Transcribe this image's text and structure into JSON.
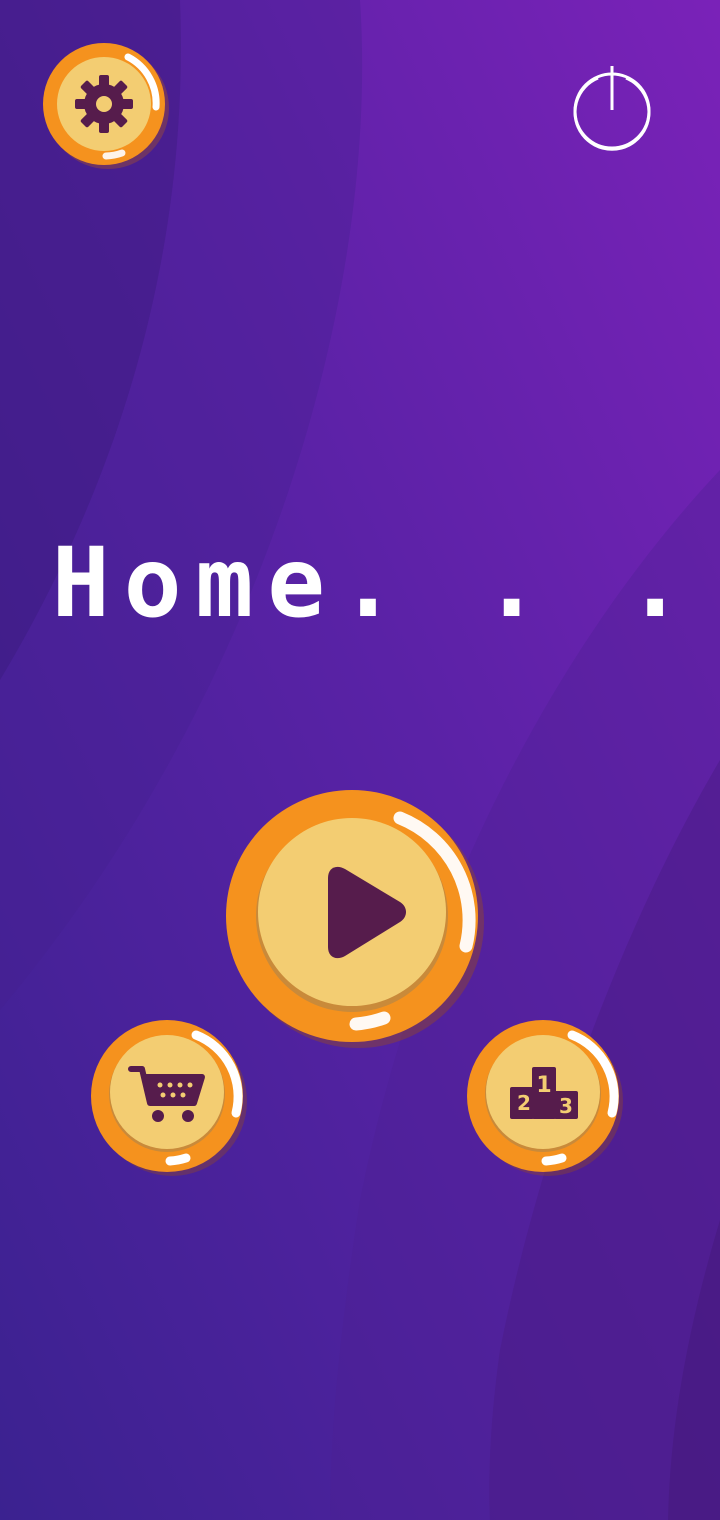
{
  "screen": {
    "title": "Home. . ."
  },
  "buttons": {
    "settings": {
      "icon": "gear-icon"
    },
    "power": {
      "icon": "power-icon"
    },
    "play": {
      "icon": "play-icon"
    },
    "shop": {
      "icon": "shopping-cart-icon"
    },
    "leaderboard": {
      "icon": "podium-icon",
      "ranks": [
        "2",
        "1",
        "3"
      ]
    }
  },
  "colors": {
    "bg_top_right": "#7a22b8",
    "bg_bottom_left": "#3a1e8c",
    "coin_rim": "#f5921e",
    "coin_face": "#f3cd72",
    "icon": "#561c4c",
    "highlight": "#ffffff"
  }
}
